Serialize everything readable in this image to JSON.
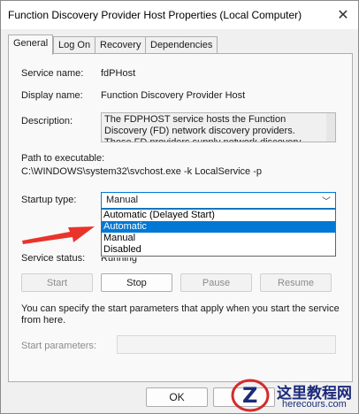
{
  "window": {
    "title": "Function Discovery Provider Host Properties (Local Computer)"
  },
  "tabs": [
    {
      "label": "General",
      "active": true
    },
    {
      "label": "Log On",
      "active": false
    },
    {
      "label": "Recovery",
      "active": false
    },
    {
      "label": "Dependencies",
      "active": false
    }
  ],
  "general": {
    "service_name_label": "Service name:",
    "service_name": "fdPHost",
    "display_name_label": "Display name:",
    "display_name": "Function Discovery Provider Host",
    "description_label": "Description:",
    "description": "The FDPHOST service hosts the Function Discovery (FD) network discovery providers. These FD providers supply network discovery services for",
    "path_label": "Path to executable:",
    "path": "C:\\WINDOWS\\system32\\svchost.exe -k LocalService -p",
    "startup_label": "Startup type:",
    "startup_value": "Manual",
    "startup_options": [
      "Automatic (Delayed Start)",
      "Automatic",
      "Manual",
      "Disabled"
    ],
    "startup_highlighted": "Automatic",
    "status_label": "Service status:",
    "status_value": "Running",
    "buttons": {
      "start": "Start",
      "stop": "Stop",
      "pause": "Pause",
      "resume": "Resume"
    },
    "info_text": "You can specify the start parameters that apply when you start the service from here.",
    "start_params_label": "Start parameters:",
    "start_params_value": ""
  },
  "dialog_buttons": {
    "ok": "OK"
  },
  "watermark": {
    "cn": "这里教程网",
    "en": "herecours.com"
  },
  "colors": {
    "accent": "#0078d4",
    "arrow": "#e8342c",
    "watermark": "#1c2a7a"
  },
  "icons": {
    "close": "close-icon",
    "dropdown": "chevron-down-icon",
    "arrow": "red-arrow-icon"
  }
}
